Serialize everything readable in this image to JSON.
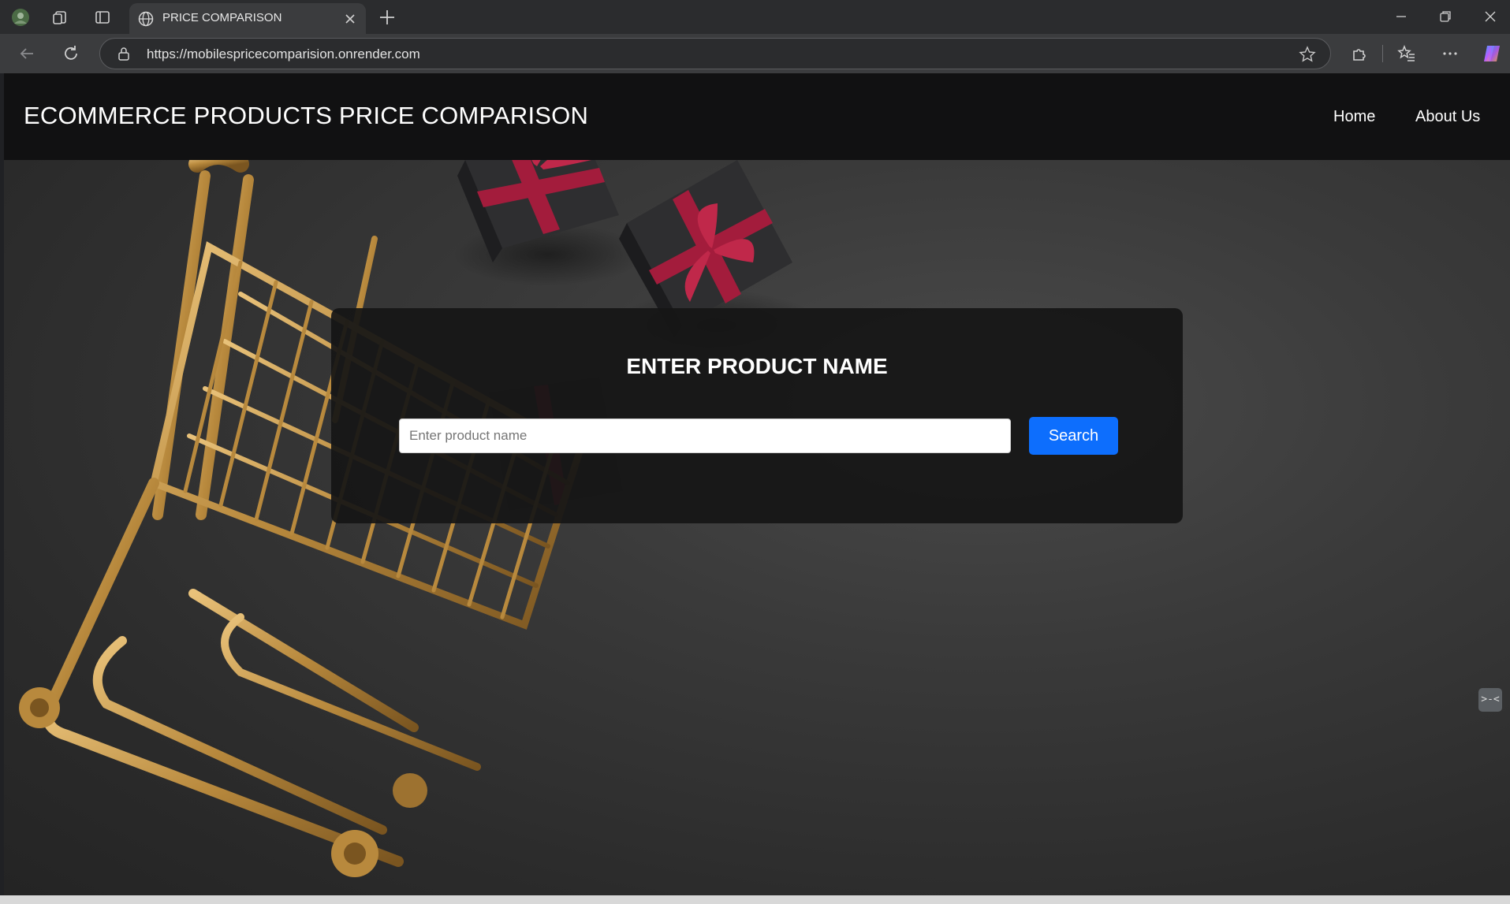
{
  "browser": {
    "tab_title": "PRICE COMPARISON",
    "url": "https://mobilespricecomparision.onrender.com",
    "icons": [
      "profile-icon",
      "collections-icon",
      "tab-actions-icon",
      "globe-icon",
      "close-tab-icon",
      "new-tab-icon",
      "back-icon",
      "reload-icon",
      "lock-icon",
      "favorite-star-icon",
      "extensions-icon",
      "favorites-icon",
      "more-icon",
      "copilot-icon",
      "minimize-icon",
      "restore-icon",
      "close-window-icon"
    ]
  },
  "header": {
    "brand": "ECOMMERCE PRODUCTS PRICE COMPARISON",
    "nav": [
      {
        "label": "Home"
      },
      {
        "label": "About Us"
      }
    ]
  },
  "search": {
    "heading": "ENTER PRODUCT NAME",
    "placeholder": "Enter product name",
    "value": "",
    "button_label": "Search"
  },
  "colors": {
    "header_bg": "#111112",
    "button": "#0d6efd",
    "card_bg": "#161616"
  }
}
